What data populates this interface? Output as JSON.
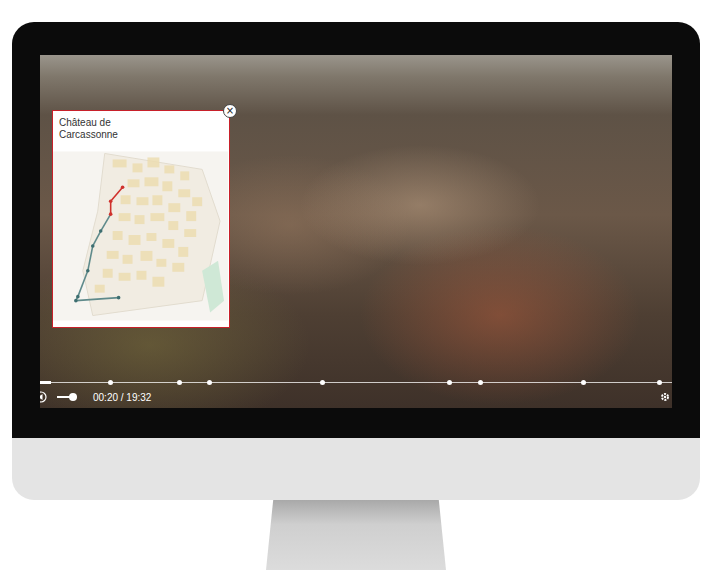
{
  "player": {
    "time": "00:20 / 19:32",
    "progress": 0.017,
    "volume": {
      "level": 0.8
    },
    "chapters": [
      {
        "level": 0.111
      },
      {
        "level": 0.22
      },
      {
        "level": 0.268
      },
      {
        "level": 0.446
      },
      {
        "level": 0.647
      },
      {
        "level": 0.696
      },
      {
        "level": 0.859
      },
      {
        "level": 0.979
      }
    ]
  },
  "map": {
    "title": "Château de Carcassonne",
    "close": "×",
    "stops": [
      {
        "visited": true
      },
      {
        "visited": true
      },
      {
        "visited": true
      },
      {
        "visited": false
      },
      {
        "visited": false
      },
      {
        "visited": false
      },
      {
        "visited": false
      },
      {
        "visited": false
      },
      {
        "visited": false
      }
    ]
  }
}
